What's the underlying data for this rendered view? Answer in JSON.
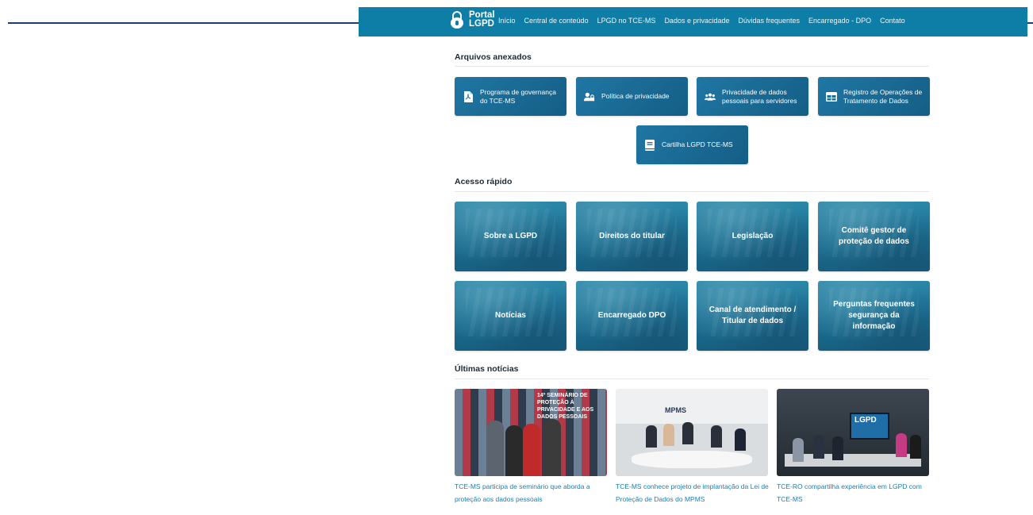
{
  "header": {
    "brand_line1": "Portal",
    "brand_line2": "LGPD",
    "nav": [
      "Início",
      "Central de conteúdo",
      "LPGD no TCE-MS",
      "Dados e privacidade",
      "Dúvidas frequentes",
      "Encarregado - DPO",
      "Contato"
    ]
  },
  "attachments": {
    "title": "Arquivos anexados",
    "items": [
      {
        "label": "Programa de governança do TCE-MS",
        "icon": "pdf-file-icon"
      },
      {
        "label": "Política de privacidade",
        "icon": "user-lock-icon"
      },
      {
        "label": "Privacidade de dados pessoais para servidores",
        "icon": "users-icon"
      },
      {
        "label": "Registro de Operações de Tratamento de Dados",
        "icon": "table-icon"
      },
      {
        "label": "Cartilha LGPD TCE-MS",
        "icon": "book-icon"
      }
    ]
  },
  "quick_access": {
    "title": "Acesso rápido",
    "items": [
      "Sobre a LGPD",
      "Direitos do titular",
      "Legislação",
      "Comitê gestor de proteção de dados",
      "Notícias",
      "Encarregado DPO",
      "Canal de atendimento / Titular de dados",
      "Perguntas frequentes segurança da informação"
    ]
  },
  "news": {
    "title": "Últimas notícias",
    "items": [
      {
        "caption": "TCE-MS participa de seminário que aborda a proteção aos dados pessoais",
        "image_text": "14º SEMINÁRIO DE PROTEÇÃO À PRIVACIDADE E AOS DADOS PESSOAIS"
      },
      {
        "caption": "TCE-MS conhece projeto de implantação da Lei de Proteção de Dados do MPMS",
        "image_text": "MPMS"
      },
      {
        "caption": "TCE-RO compartilha experiência em LGPD com TCE-MS",
        "image_text": "LGPD"
      }
    ]
  },
  "colors": {
    "header": "#0f7ea6",
    "accent": "#1a7fb3",
    "rule": "#1e3d77"
  }
}
